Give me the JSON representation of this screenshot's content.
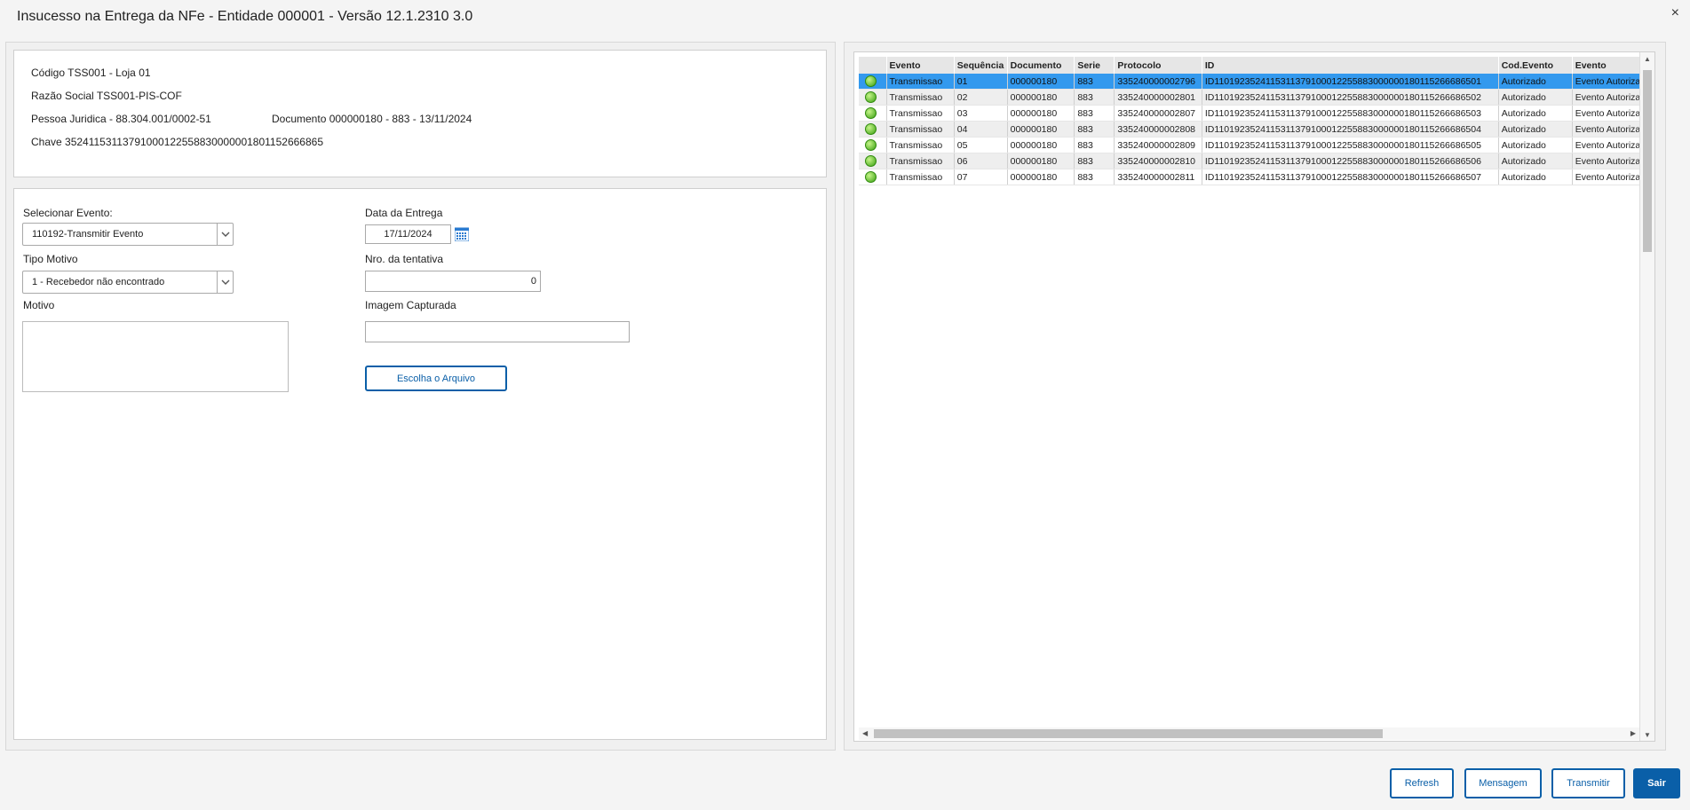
{
  "window": {
    "title": "Insucesso na Entrega da NFe - Entidade 000001 - Versão 12.1.2310  3.0",
    "close_label": "×"
  },
  "info": {
    "codigo": "Código TSS001 - Loja 01",
    "razao_social": "Razão Social TSS001-PIS-COF",
    "pessoa_juridica": "Pessoa Juridica - 88.304.001/0002-51",
    "documento": "Documento 000000180 - 883 - 13/11/2024",
    "chave": "Chave 35241153113791000122558830000001801152666865"
  },
  "form": {
    "selecionar_evento_label": "Selecionar Evento:",
    "selecionar_evento_value": "110192-Transmitir Evento",
    "tipo_motivo_label": "Tipo Motivo",
    "tipo_motivo_value": "1 - Recebedor não encontrado",
    "motivo_label": "Motivo",
    "data_entrega_label": "Data da Entrega",
    "data_entrega_value": "17/11/2024",
    "nro_tentativa_label": "Nro. da tentativa",
    "nro_tentativa_value": "0",
    "imagem_label": "Imagem Capturada",
    "imagem_value": "",
    "escolha_arquivo_label": "Escolha o Arquivo"
  },
  "grid": {
    "columns": [
      "",
      "Evento",
      "Sequência",
      "Documento",
      "Serie",
      "Protocolo",
      "ID",
      "Cod.Evento",
      "Evento"
    ],
    "rows": [
      {
        "status_icon": "green-status-icon",
        "evento": "Transmissao",
        "seq": "01",
        "documento": "000000180",
        "serie": "883",
        "protocolo": "335240000002796",
        "id": "ID1101923524115311379100012255883000000180115266686501",
        "cod_evento": "Autorizado",
        "evento2": "Evento Autorizado"
      },
      {
        "status_icon": "green-status-icon",
        "evento": "Transmissao",
        "seq": "02",
        "documento": "000000180",
        "serie": "883",
        "protocolo": "335240000002801",
        "id": "ID1101923524115311379100012255883000000180115266686502",
        "cod_evento": "Autorizado",
        "evento2": "Evento Autorizado"
      },
      {
        "status_icon": "green-status-icon",
        "evento": "Transmissao",
        "seq": "03",
        "documento": "000000180",
        "serie": "883",
        "protocolo": "335240000002807",
        "id": "ID1101923524115311379100012255883000000180115266686503",
        "cod_evento": "Autorizado",
        "evento2": "Evento Autorizado"
      },
      {
        "status_icon": "green-status-icon",
        "evento": "Transmissao",
        "seq": "04",
        "documento": "000000180",
        "serie": "883",
        "protocolo": "335240000002808",
        "id": "ID1101923524115311379100012255883000000180115266686504",
        "cod_evento": "Autorizado",
        "evento2": "Evento Autorizado"
      },
      {
        "status_icon": "green-status-icon",
        "evento": "Transmissao",
        "seq": "05",
        "documento": "000000180",
        "serie": "883",
        "protocolo": "335240000002809",
        "id": "ID1101923524115311379100012255883000000180115266686505",
        "cod_evento": "Autorizado",
        "evento2": "Evento Autorizado"
      },
      {
        "status_icon": "green-status-icon",
        "evento": "Transmissao",
        "seq": "06",
        "documento": "000000180",
        "serie": "883",
        "protocolo": "335240000002810",
        "id": "ID1101923524115311379100012255883000000180115266686506",
        "cod_evento": "Autorizado",
        "evento2": "Evento Autorizado"
      },
      {
        "status_icon": "green-status-icon",
        "evento": "Transmissao",
        "seq": "07",
        "documento": "000000180",
        "serie": "883",
        "protocolo": "335240000002811",
        "id": "ID1101923524115311379100012255883000000180115266686507",
        "cod_evento": "Autorizado",
        "evento2": "Evento Autorizado"
      }
    ],
    "selected_row": 0
  },
  "buttons": {
    "refresh": "Refresh",
    "mensagem": "Mensagem",
    "transmitir": "Transmitir",
    "sair": "Sair"
  },
  "colors": {
    "accent": "#0a5fa8",
    "selection": "#3399ee",
    "status_ok": "#3aa012"
  }
}
